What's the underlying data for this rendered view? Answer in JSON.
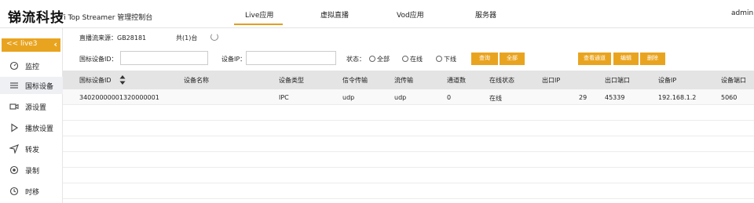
{
  "header": {
    "brand": "锑流科技",
    "subtitle": "Ti Top Streamer 管理控制台",
    "nav": [
      "Live应用",
      "虚拟直播",
      "Vod应用",
      "服务器"
    ],
    "user": "admin"
  },
  "sidebar": {
    "app": "<< live3",
    "collapse": "‹",
    "items": [
      {
        "label": "监控",
        "icon": "gauge-icon"
      },
      {
        "label": "国标设备",
        "icon": "list-icon"
      },
      {
        "label": "源设置",
        "icon": "camera-icon"
      },
      {
        "label": "播放设置",
        "icon": "play-icon"
      },
      {
        "label": "转发",
        "icon": "send-icon"
      },
      {
        "label": "录制",
        "icon": "record-icon"
      },
      {
        "label": "时移",
        "icon": "clock-icon"
      }
    ]
  },
  "toolbar": {
    "source": "直播流来源：GB28181",
    "count": "共(1)台"
  },
  "filters": {
    "device_id_label": "国标设备ID：",
    "device_ip_label": "设备IP：",
    "status_label": "状态：",
    "status_options": [
      "全部",
      "在线",
      "下线"
    ],
    "query": "查询",
    "all": "全部",
    "view_channels": "查看通道",
    "edit": "编辑",
    "delete": "删除"
  },
  "table": {
    "columns": [
      "国标设备ID",
      "设备名称",
      "设备类型",
      "信令传输",
      "流传输",
      "通道数",
      "在线状态",
      "出口IP",
      "出口端口",
      "设备IP",
      "设备端口"
    ],
    "rows": [
      [
        "34020000001320000001",
        "",
        "IPC",
        "udp",
        "udp",
        "0",
        "在线",
        "29",
        "45339",
        "192.168.1.2",
        "5060"
      ]
    ]
  }
}
